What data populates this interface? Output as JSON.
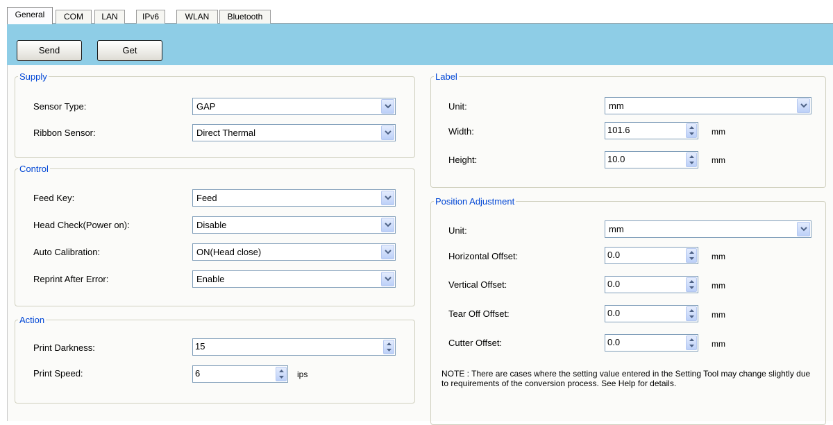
{
  "tabs": [
    {
      "label": "General",
      "active": true
    },
    {
      "label": "COM",
      "active": false
    },
    {
      "label": "LAN",
      "active": false
    },
    {
      "label": "IPv6",
      "active": false
    },
    {
      "label": "WLAN",
      "active": false
    },
    {
      "label": "Bluetooth",
      "active": false
    }
  ],
  "toolbar": {
    "send_label": "Send",
    "get_label": "Get",
    "background": "#8ecde6"
  },
  "supply": {
    "title": "Supply",
    "sensor_type_label": "Sensor Type:",
    "sensor_type_value": "GAP",
    "ribbon_sensor_label": "Ribbon Sensor:",
    "ribbon_sensor_value": "Direct Thermal"
  },
  "control": {
    "title": "Control",
    "feed_key_label": "Feed Key:",
    "feed_key_value": "Feed",
    "head_check_label": "Head Check(Power on):",
    "head_check_value": "Disable",
    "auto_calibration_label": "Auto Calibration:",
    "auto_calibration_value": "ON(Head close)",
    "reprint_label": "Reprint After Error:",
    "reprint_value": "Enable"
  },
  "action": {
    "title": "Action",
    "print_darkness_label": "Print Darkness:",
    "print_darkness_value": "15",
    "print_speed_label": "Print Speed:",
    "print_speed_value": "6",
    "print_speed_unit": "ips"
  },
  "label": {
    "title": "Label",
    "unit_label": "Unit:",
    "unit_value": "mm",
    "width_label": "Width:",
    "width_value": "101.6",
    "width_unit": "mm",
    "height_label": "Height:",
    "height_value": "10.0",
    "height_unit": "mm"
  },
  "position": {
    "title": "Position Adjustment",
    "unit_label": "Unit:",
    "unit_value": "mm",
    "horizontal_label": "Horizontal Offset:",
    "horizontal_value": "0.0",
    "horizontal_unit": "mm",
    "vertical_label": "Vertical Offset:",
    "vertical_value": "0.0",
    "vertical_unit": "mm",
    "tear_label": "Tear Off Offset:",
    "tear_value": "0.0",
    "tear_unit": "mm",
    "cutter_label": "Cutter Offset:",
    "cutter_value": "0.0",
    "cutter_unit": "mm"
  },
  "note": "NOTE : There are cases where the setting value entered in the Setting Tool may change slightly due to requirements of the conversion process. See Help for details.",
  "icons": {
    "dropdown": "chevron-down-icon",
    "spin_up": "spin-up-icon",
    "spin_down": "spin-down-icon"
  },
  "colors": {
    "group_title": "#0046d5",
    "group_border": "#d0d0bf",
    "field_border": "#7f9db9"
  }
}
